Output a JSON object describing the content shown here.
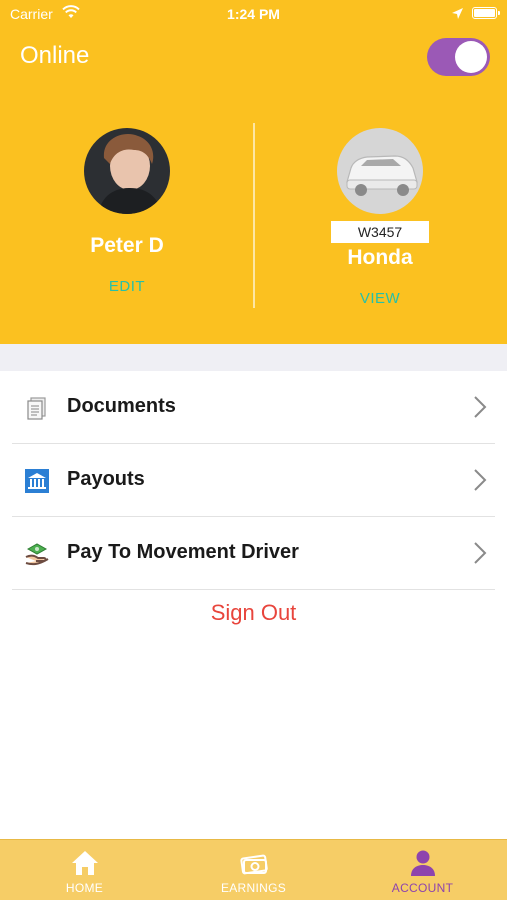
{
  "status_bar": {
    "carrier": "Carrier",
    "time": "1:24 PM"
  },
  "header": {
    "online_label": "Online",
    "toggle_on": true,
    "driver": {
      "name": "Peter D",
      "action": "EDIT"
    },
    "vehicle": {
      "plate": "W3457",
      "name": "Honda",
      "action": "VIEW"
    }
  },
  "menu": {
    "items": [
      {
        "label": "Documents",
        "icon": "documents-icon"
      },
      {
        "label": "Payouts",
        "icon": "bank-icon"
      },
      {
        "label": "Pay To Movement Driver",
        "icon": "money-hand-icon"
      }
    ],
    "sign_out": "Sign Out"
  },
  "tabbar": {
    "tabs": [
      {
        "label": "HOME",
        "icon": "home-icon",
        "active": false
      },
      {
        "label": "EARNINGS",
        "icon": "cash-icon",
        "active": false
      },
      {
        "label": "ACCOUNT",
        "icon": "person-icon",
        "active": true
      }
    ]
  },
  "colors": {
    "brand_yellow": "#FBC120",
    "toggle_purple": "#9B59B6",
    "link_teal": "#27C0A8",
    "sign_out_red": "#E8453C",
    "tab_active": "#8E44AD"
  }
}
